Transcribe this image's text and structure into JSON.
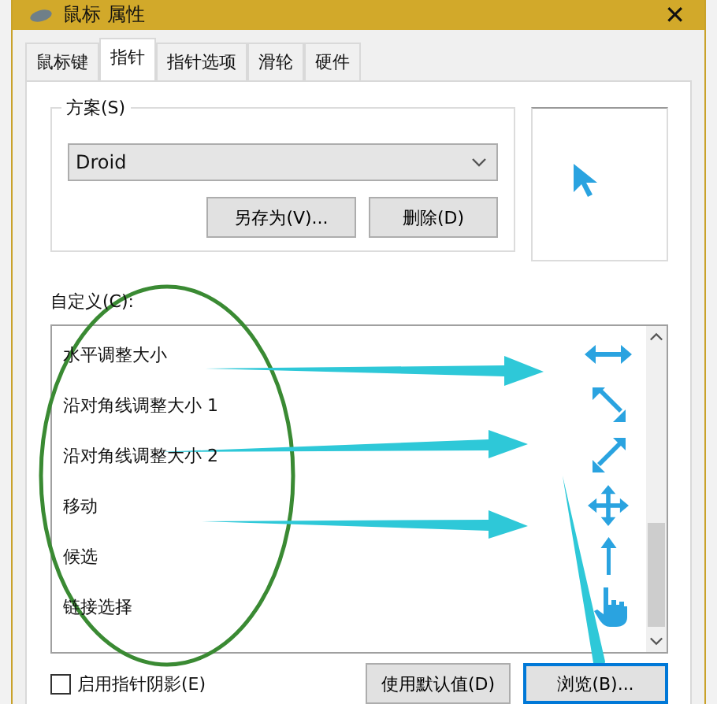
{
  "window": {
    "title": "鼠标 属性",
    "close": "✕"
  },
  "tabs": [
    {
      "label": "鼠标键",
      "selected": false
    },
    {
      "label": "指针",
      "selected": true
    },
    {
      "label": "指针选项",
      "selected": false
    },
    {
      "label": "滑轮",
      "selected": false
    },
    {
      "label": "硬件",
      "selected": false
    }
  ],
  "scheme": {
    "label": "方案(S)",
    "value": "Droid",
    "buttons": [
      "另存为(V)...",
      "删除(D)"
    ]
  },
  "custom": {
    "label": "自定义(C):",
    "items": [
      {
        "name": "水平调整大小",
        "kind": "horizontal"
      },
      {
        "name": "沿对角线调整大小 1",
        "kind": "diagonal1"
      },
      {
        "name": "沿对角线调整大小 2",
        "kind": "diagonal2"
      },
      {
        "name": "移动",
        "kind": "move"
      },
      {
        "name": "候选",
        "kind": "up"
      },
      {
        "name": "链接选择",
        "kind": "hand"
      }
    ]
  },
  "shadow": {
    "label": "启用指针阴影(E)",
    "checked": false
  },
  "buttons": [
    "使用默认值(D)",
    "浏览(B)..."
  ]
}
